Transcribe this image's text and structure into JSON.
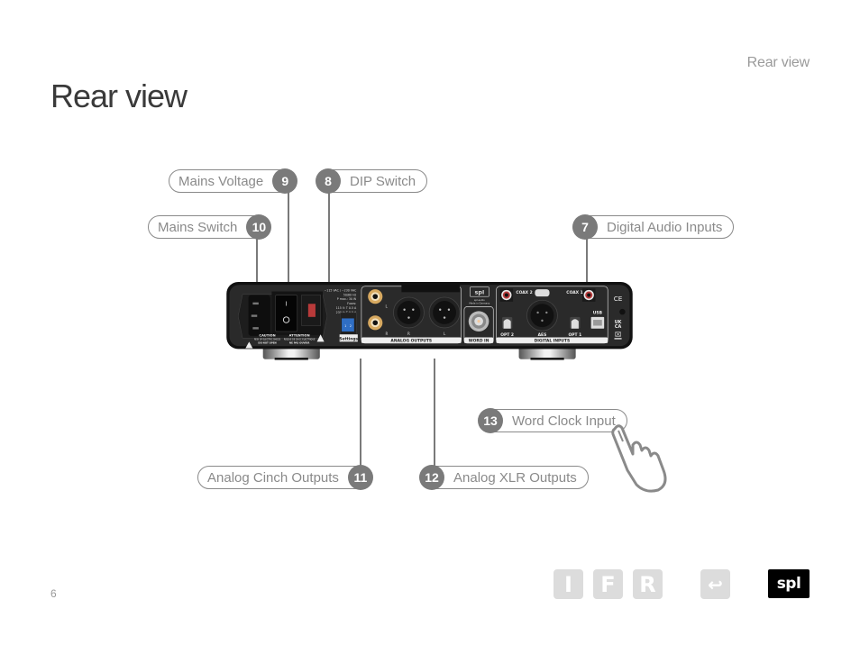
{
  "header": {
    "section_title": "Rear view"
  },
  "page": {
    "title": "Rear view",
    "number": "6"
  },
  "callouts": [
    {
      "number": "9",
      "label": "Mains Voltage"
    },
    {
      "number": "8",
      "label": "DIP Switch"
    },
    {
      "number": "10",
      "label": "Mains Switch"
    },
    {
      "number": "7",
      "label": "Digital Audio Inputs"
    },
    {
      "number": "13",
      "label": "Word Clock Input"
    },
    {
      "number": "11",
      "label": "Analog Cinch Outputs"
    },
    {
      "number": "12",
      "label": "Analog XLR Outputs"
    }
  ],
  "device": {
    "power_label_lines": [
      "~115 VAC / ~230 VAC",
      "50/60 Hz",
      "P max.: 30 W",
      "Fuses:",
      "115 V: T 0.5 A",
      "230 V: T 0.5 A"
    ],
    "caution": {
      "title": "CAUTION",
      "line1": "RISK OF ELECTRIC SHOCK",
      "line2": "DO NOT OPEN"
    },
    "attention": {
      "title": "ATTENTION",
      "line1": "RISQUE DE CHOC ÉLECTRIQUE",
      "line2": "NE PAS OUVRIR"
    },
    "switch_on": "I",
    "switch_off": "O",
    "settings_label": "Settings",
    "dip_labels": [
      "1",
      "2"
    ],
    "analog_outputs_label": "ANALOG OUTPUTS",
    "cinch_l": "L",
    "cinch_r": "R",
    "xlr_r": "R",
    "xlr_l": "L",
    "brand": "spl",
    "brand_line1": "spl.audio",
    "brand_line2": "Made in Germany",
    "word_in_label": "WORD IN",
    "coax2": "COAX 2",
    "coax1": "COAX 1",
    "opt2": "OPT 2",
    "aes": "AES",
    "opt1": "OPT 1",
    "usb": "USB",
    "digital_inputs_label": "DIGITAL INPUTS",
    "ce": "CE",
    "ukca_1": "UK",
    "ukca_2": "CA"
  },
  "nav": {
    "buttons": [
      {
        "label": "I"
      },
      {
        "label": "F"
      },
      {
        "label": "R"
      },
      {
        "label": "↩"
      }
    ],
    "logo": "spl"
  },
  "colors": {
    "badge": "#7a7a7a",
    "outline": "#8a8a8a",
    "nav_button": "#dcdcdc",
    "device_body": "#1e1e1e"
  }
}
